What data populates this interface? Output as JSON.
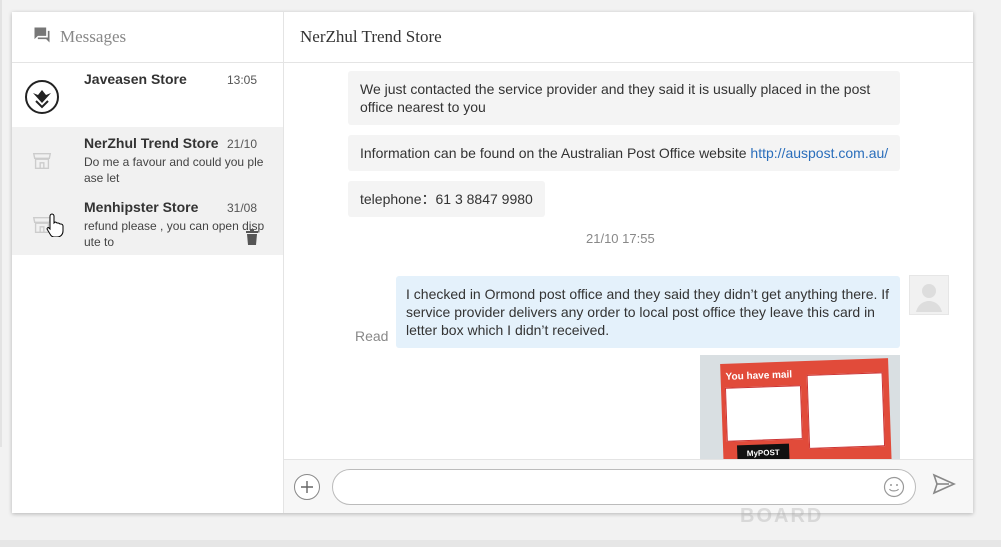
{
  "sidebar": {
    "title": "Messages",
    "conversations": [
      {
        "name": "Javeasen Store",
        "time": "13:05",
        "preview": ""
      },
      {
        "name": "NerZhul Trend Store",
        "time": "21/10",
        "preview": "Do me a favour and could you ple ase let"
      },
      {
        "name": "Menhipster Store",
        "time": "31/08",
        "preview": "refund please , you can open disp ute to"
      }
    ]
  },
  "chat": {
    "title": "NerZhul Trend Store",
    "messages": {
      "m1": "We just contacted the service provider and they said it is usually placed in the post office nearest to you",
      "m2_text": "Information can be found on the Australian Post Office website ",
      "m2_link": "http://auspost.com.au/",
      "m3": "telephone：61 3 8847 9980",
      "timestamp": "21/10 17:55",
      "m4": "I checked in Ormond post office and they said they didn’t get anything there. If service provider delivers any order to local post office they leave this card in letter box which I didn’t received.",
      "read_status": "Read",
      "photo_caption": "You have mail",
      "photo_brand": "MyPOST"
    }
  },
  "input": {
    "placeholder": "",
    "value": ""
  },
  "watermark": "BOARD"
}
